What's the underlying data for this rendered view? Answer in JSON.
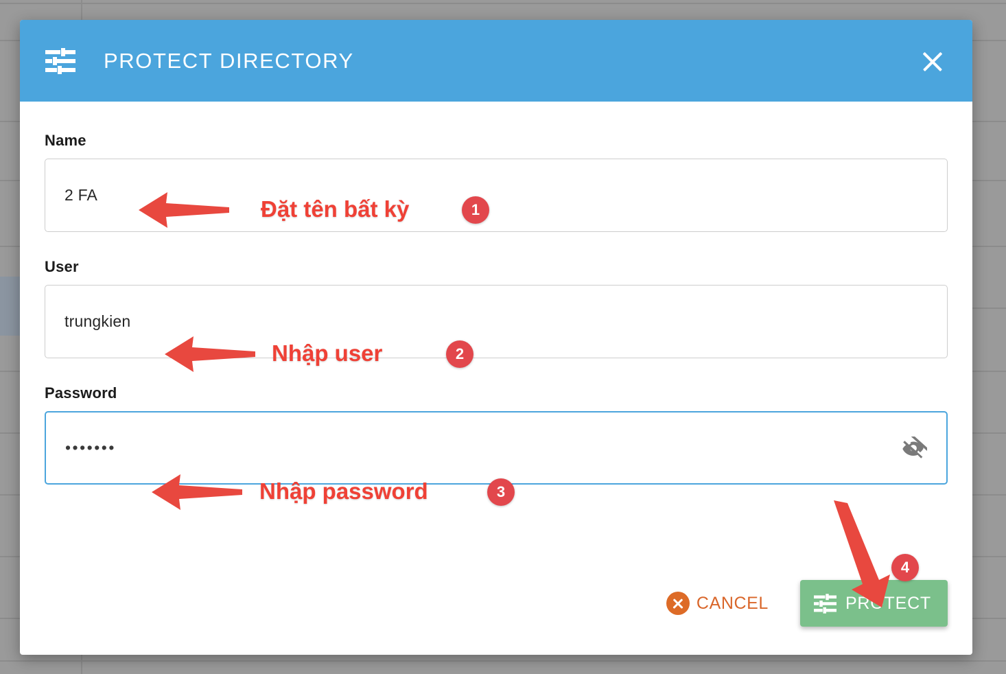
{
  "dialog": {
    "title": "PROTECT DIRECTORY",
    "header_icon": "tune-icon",
    "close_icon": "close-icon",
    "header_color": "#4ba5dd"
  },
  "form": {
    "name": {
      "label": "Name",
      "value": "2 FA",
      "placeholder": "",
      "focused": false
    },
    "user": {
      "label": "User",
      "value": "trungkien",
      "placeholder": "",
      "focused": false
    },
    "password": {
      "label": "Password",
      "value": "•••••••",
      "placeholder": "",
      "focused": true,
      "toggle_icon": "eye-off-icon"
    }
  },
  "footer": {
    "cancel_label": "CANCEL",
    "cancel_icon": "cancel-circle-icon",
    "cancel_color": "#d9662a",
    "protect_label": "PROTECT",
    "protect_icon": "tune-icon",
    "protect_color": "#7bc08b"
  },
  "annotations": {
    "color": "#ef4136",
    "badge_color": "#e2474c",
    "items": [
      {
        "badge": "1",
        "text": "Đặt tên bất kỳ"
      },
      {
        "badge": "2",
        "text": "Nhập user"
      },
      {
        "badge": "3",
        "text": "Nhập password"
      },
      {
        "badge": "4",
        "text": ""
      }
    ]
  }
}
